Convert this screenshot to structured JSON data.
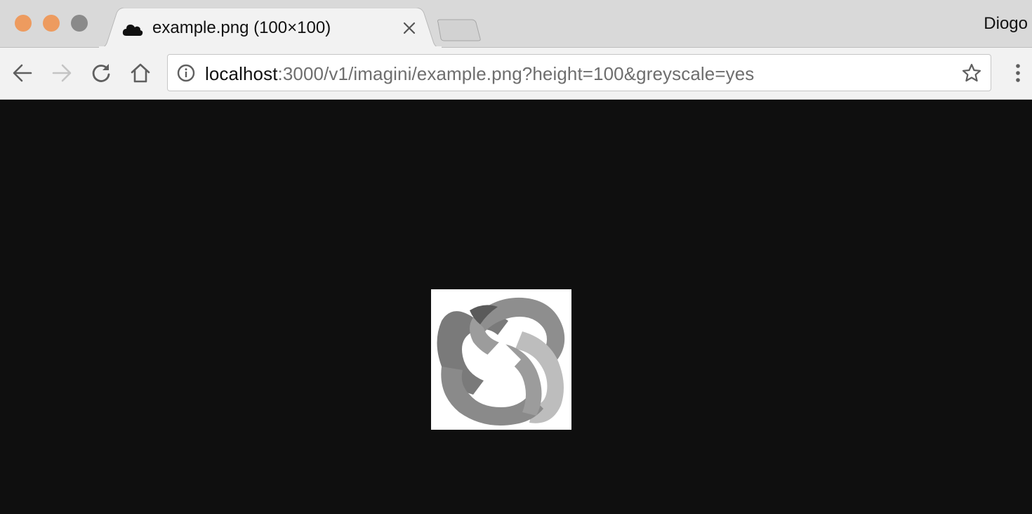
{
  "window": {
    "traffic_colors": {
      "close": "#ed9b5f",
      "minimize": "#ed9b5f",
      "maximize": "#8a8a8a"
    }
  },
  "tab": {
    "title": "example.png (100×100)",
    "favicon": "cloud-icon",
    "close_icon": "close-icon"
  },
  "profile": {
    "name": "Diogo"
  },
  "toolbar": {
    "back_icon": "back-arrow-icon",
    "forward_icon": "forward-arrow-icon",
    "reload_icon": "reload-icon",
    "home_icon": "home-icon",
    "menu_icon": "kebab-menu-icon"
  },
  "omnibox": {
    "info_icon": "info-icon",
    "url_host": "localhost",
    "url_rest": ":3000/v1/imagini/example.png?height=100&greyscale=yes",
    "star_icon": "star-icon"
  },
  "content": {
    "background": "#0f0f0f",
    "image": "greyscale-knot-image"
  }
}
